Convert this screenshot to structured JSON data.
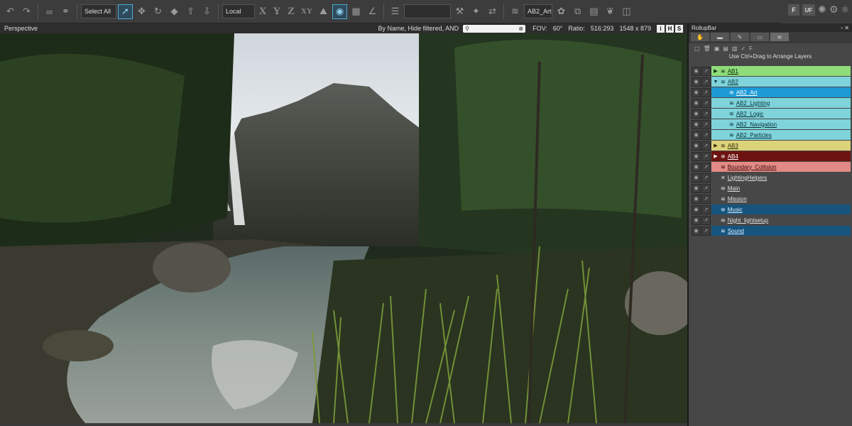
{
  "toolbar": {
    "select_mode": "Select All",
    "coord_system": "Local",
    "axes": [
      "X",
      "Y",
      "Z",
      "XY"
    ],
    "active_layer": "AB2_Art",
    "icons": [
      "undo-icon",
      "redo-icon",
      "link-icon",
      "unlink-icon",
      "select-icon",
      "move-icon",
      "rotate-icon",
      "scale-icon",
      "export-icon",
      "import-icon",
      "snap-icon",
      "grid-icon",
      "angle-icon",
      "list-icon",
      "terrain-icon",
      "layers-icon",
      "physics-icon",
      "fur-icon",
      "flowgraph-icon",
      "atom-icon"
    ],
    "right_icons": [
      "F",
      "UF"
    ]
  },
  "viewport": {
    "title": "Perspective",
    "filter_text": "By Name, Hide filtered, AND",
    "search_value": "",
    "fov_label": "FOV:",
    "fov_value": "60°",
    "ratio_label": "Ratio:",
    "ratio_value": "516:293",
    "resolution": "1548 x 879",
    "toggles": [
      "i",
      "H",
      "S"
    ]
  },
  "rollup": {
    "title": "RollupBar",
    "hint": "Use Ctrl+Drag to Arrange Layers",
    "tool_f": "F",
    "layers": [
      {
        "name": "AB1",
        "indent": 0,
        "expand": "▶",
        "bg": "#8fdc7a",
        "fg": "#0a2a0a",
        "icon": "layer"
      },
      {
        "name": "AB2",
        "indent": 0,
        "expand": "▼",
        "bg": "#7fd3da",
        "fg": "#08323a",
        "icon": "layer"
      },
      {
        "name": "AB2_Art",
        "indent": 1,
        "expand": "",
        "bg": "#1d9ad6",
        "fg": "#ffffff",
        "icon": "layer"
      },
      {
        "name": "AB2_Lighting",
        "indent": 1,
        "expand": "",
        "bg": "#7fd3da",
        "fg": "#08323a",
        "icon": "layer"
      },
      {
        "name": "AB2_Logic",
        "indent": 1,
        "expand": "",
        "bg": "#7fd3da",
        "fg": "#08323a",
        "icon": "layer"
      },
      {
        "name": "AB2_Navigation",
        "indent": 1,
        "expand": "",
        "bg": "#7fd3da",
        "fg": "#08323a",
        "icon": "layer"
      },
      {
        "name": "AB2_Particles",
        "indent": 1,
        "expand": "",
        "bg": "#7fd3da",
        "fg": "#08323a",
        "icon": "layer"
      },
      {
        "name": "AB3",
        "indent": 0,
        "expand": "▶",
        "bg": "#dcd27a",
        "fg": "#2a2a08",
        "icon": "layer"
      },
      {
        "name": "AB4",
        "indent": 0,
        "expand": "▶",
        "bg": "#6e1410",
        "fg": "#ffffff",
        "icon": "layer"
      },
      {
        "name": "Boundary_Collision",
        "indent": 0,
        "expand": "",
        "bg": "#e38a86",
        "fg": "#3a0808",
        "icon": "layer"
      },
      {
        "name": "LightingHelpers",
        "indent": 0,
        "expand": "",
        "bg": "#474747",
        "fg": "#e0e0e0",
        "icon": "cross"
      },
      {
        "name": "Main",
        "indent": 0,
        "expand": "",
        "bg": "#474747",
        "fg": "#e0e0e0",
        "icon": "layer"
      },
      {
        "name": "Mission",
        "indent": 0,
        "expand": "",
        "bg": "#474747",
        "fg": "#e0e0e0",
        "icon": "layer"
      },
      {
        "name": "Music",
        "indent": 0,
        "expand": "",
        "bg": "#16547e",
        "fg": "#e0f0ff",
        "icon": "layer"
      },
      {
        "name": "Night_lightsetup",
        "indent": 0,
        "expand": "",
        "bg": "#474747",
        "fg": "#e0e0e0",
        "icon": "layer"
      },
      {
        "name": "Sound",
        "indent": 0,
        "expand": "",
        "bg": "#16547e",
        "fg": "#e0f0ff",
        "icon": "layer"
      }
    ]
  }
}
